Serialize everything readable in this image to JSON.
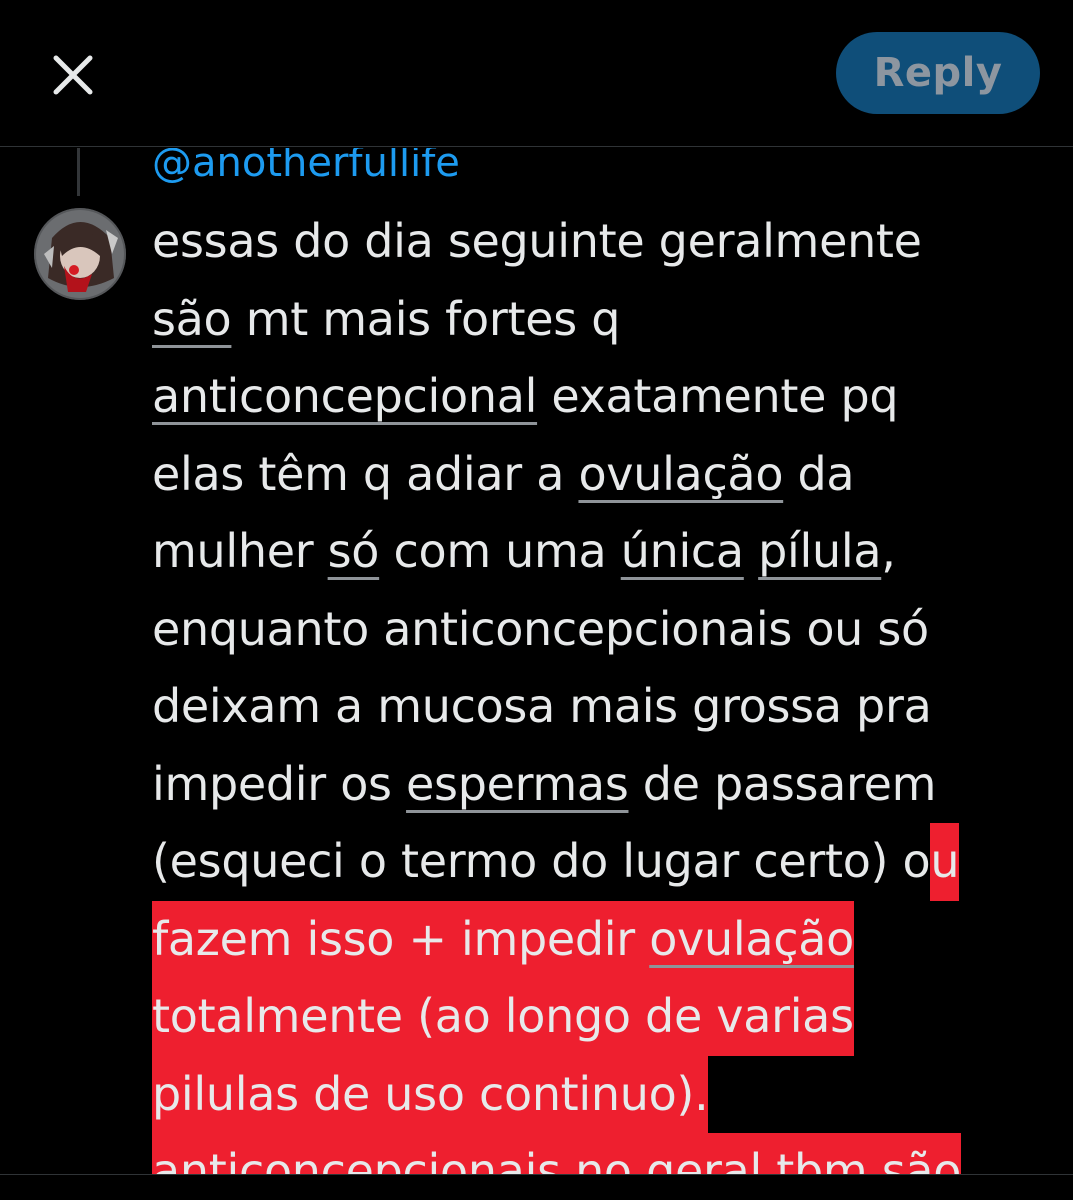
{
  "header": {
    "reply_label": "Reply",
    "close_icon": "close-icon"
  },
  "parent": {
    "handle": "@anotherfullife"
  },
  "post": {
    "avatar": "avatar",
    "lines": [
      [
        "essas do dia seguinte geralmente"
      ],
      [
        "são",
        " mt mais fortes q"
      ],
      [
        "anticoncepcional",
        " exatamente pq"
      ],
      [
        "elas têm q adiar a ",
        "ovulação",
        " da"
      ],
      [
        "mulher ",
        "só",
        " com uma ",
        "única",
        " ",
        "pílula",
        ","
      ],
      [
        "enquanto anticoncepcionais ou só"
      ],
      [
        "deixam a mucosa mais grossa pra"
      ],
      [
        "impedir os ",
        "espermas",
        " de passarem"
      ],
      [
        "(esqueci o termo do lugar certo) o",
        "u"
      ],
      [
        "fazem isso + impedir ",
        "ovulação"
      ],
      [
        "totalmente (ao longo de varias"
      ],
      [
        "pilulas de uso continuo)."
      ],
      [
        "anticoncepcionais no geral tbm são"
      ]
    ]
  },
  "colors": {
    "background": "#000000",
    "text": "#e7e9ea",
    "link": "#1d9bf0",
    "highlight": "#ee1f2f",
    "reply_button": "#0f4e79"
  }
}
